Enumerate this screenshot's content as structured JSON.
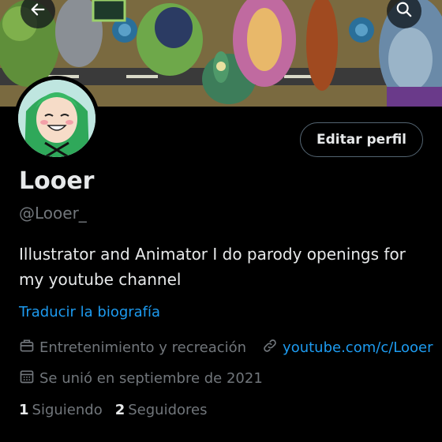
{
  "profile": {
    "name": "Looer",
    "handle": "@Looer_",
    "bio_line1": "Illustrator and Animator I do parody openings for",
    "bio_line2": "my youtube channel",
    "translate_label": "Traducir la biografía",
    "category": "Entretenimiento y recreación",
    "website": "youtube.com/c/Looer",
    "joined": "Se unió en septiembre de 2021",
    "following_count": "1",
    "following_label": "Siguiendo",
    "followers_count": "2",
    "followers_label": "Seguidores"
  },
  "actions": {
    "edit_profile_label": "Editar perfil"
  },
  "icons": {
    "back": "arrow-left-icon",
    "search": "search-icon",
    "category": "briefcase-icon",
    "website": "link-icon",
    "joined": "calendar-icon"
  },
  "colors": {
    "background": "#000000",
    "primary_text": "#e7e9ea",
    "secondary_text": "#71767b",
    "link": "#1d9bf0",
    "button_border": "#536471"
  }
}
